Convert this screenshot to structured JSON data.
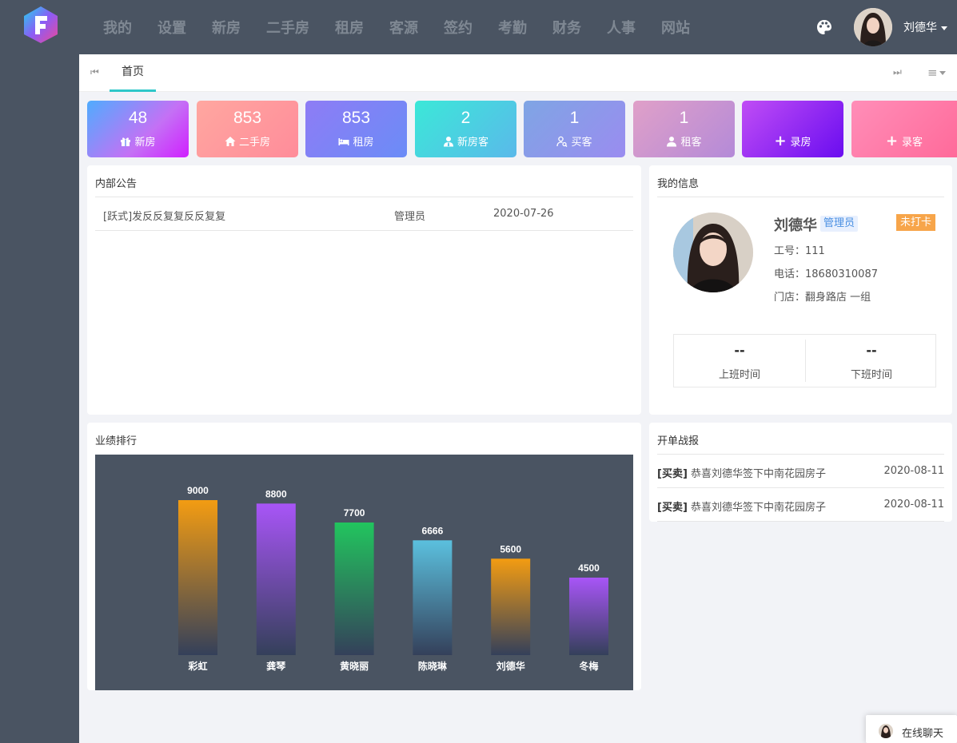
{
  "nav": [
    "我的",
    "设置",
    "新房",
    "二手房",
    "租房",
    "客源",
    "签约",
    "考勤",
    "财务",
    "人事",
    "网站"
  ],
  "user": {
    "name": "刘德华"
  },
  "tabs": {
    "home": "首页"
  },
  "cards": [
    {
      "num": "48",
      "label": "新房",
      "icon": "gift-icon"
    },
    {
      "num": "853",
      "label": "二手房",
      "icon": "house-icon"
    },
    {
      "num": "853",
      "label": "租房",
      "icon": "bed-icon"
    },
    {
      "num": "2",
      "label": "新房客",
      "icon": "user-tie-icon"
    },
    {
      "num": "1",
      "label": "买客",
      "icon": "user-search-icon"
    },
    {
      "num": "1",
      "label": "租客",
      "icon": "user-icon"
    },
    {
      "num": "",
      "label": "录房",
      "icon": "plus-icon"
    },
    {
      "num": "",
      "label": "录客",
      "icon": "plus-icon"
    }
  ],
  "notice": {
    "title": "内部公告",
    "rows": [
      {
        "title": "[跃式]发反反复复反反复复",
        "author": "管理员",
        "date": "2020-07-26"
      }
    ]
  },
  "myinfo": {
    "title": "我的信息",
    "name": "刘德华",
    "role": "管理员",
    "status": "未打卡",
    "job_no": "工号：111",
    "phone": "电话：18680310087",
    "store": "门店：翻身路店 一组",
    "clock_in_value": "--",
    "clock_in_label": "上班时间",
    "clock_out_value": "--",
    "clock_out_label": "下班时间"
  },
  "ranking": {
    "title": "业绩排行"
  },
  "chart_data": {
    "type": "bar",
    "title": "",
    "categories": [
      "彩虹",
      "龚琴",
      "黄晓丽",
      "陈晓琳",
      "刘德华",
      "冬梅"
    ],
    "values": [
      9000,
      8800,
      7700,
      6666,
      5600,
      4500
    ],
    "ylim": [
      0,
      9000
    ],
    "grid": false,
    "colors": [
      "#f39c12",
      "#a855f7",
      "#22c55e",
      "#5bc0de",
      "#f39c12",
      "#a855f7"
    ]
  },
  "report": {
    "title": "开单战报",
    "rows": [
      {
        "tag": "[买卖]",
        "text": " 恭喜刘德华签下中南花园房子",
        "date": "2020-08-11"
      },
      {
        "tag": "[买卖]",
        "text": " 恭喜刘德华签下中南花园房子",
        "date": "2020-08-11"
      }
    ]
  },
  "chat": {
    "label": "在线聊天"
  }
}
